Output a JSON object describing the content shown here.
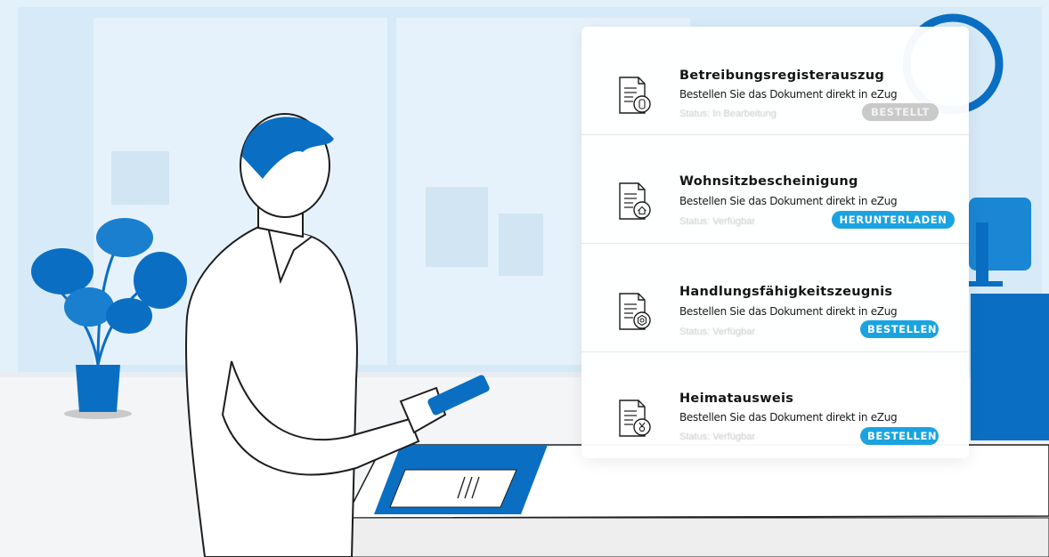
{
  "colors": {
    "brand_blue": "#0a6fc2",
    "button_blue": "#1aa3e0",
    "button_disabled": "#c9c9c9"
  },
  "documents": [
    {
      "title": "Betreibungsregisterauszug",
      "subtitle": "Bestellen Sie das Dokument direkt in eZug",
      "status": "Status: In Bearbeitung",
      "button": "BESTELLT",
      "button_state": "disabled",
      "icon": "document-coins-icon"
    },
    {
      "title": "Wohnsitzbescheinigung",
      "subtitle": "Bestellen Sie das Dokument direkt in eZug",
      "status": "Status: Verfügbar",
      "button": "HERUNTERLADEN",
      "button_state": "active",
      "icon": "document-house-icon"
    },
    {
      "title": "Handlungsfähigkeitszeugnis",
      "subtitle": "Bestellen Sie das Dokument direkt in eZug",
      "status": "Status: Verfügbar",
      "button": "BESTELLEN",
      "button_state": "active",
      "icon": "document-seal-icon"
    },
    {
      "title": "Heimatausweis",
      "subtitle": "Bestellen Sie das Dokument direkt in eZug",
      "status": "Status: Verfügbar",
      "button": "BESTELLEN",
      "button_state": "active",
      "icon": "document-medal-icon"
    }
  ]
}
